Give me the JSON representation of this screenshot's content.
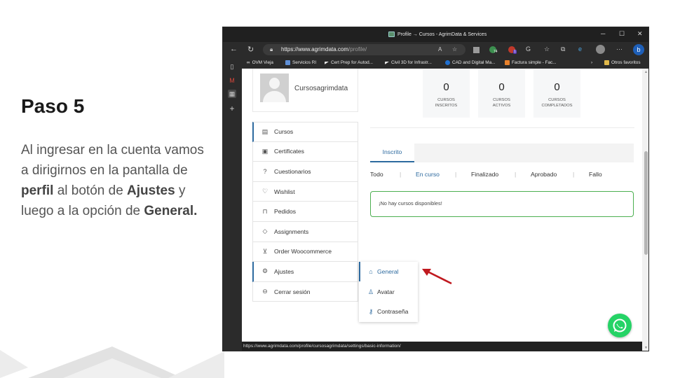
{
  "slide": {
    "title": "Paso 5",
    "text_parts": [
      "Al ingresar en la cuenta vamos a dirigirnos en la pantalla de ",
      "perfil",
      " al botón de ",
      "Ajustes",
      " y luego a la opción de ",
      "General."
    ]
  },
  "browser": {
    "title": "Profile → Cursos - AgrimData & Services",
    "url_domain": "https://www.agrimdata.com",
    "url_path": "/profile/",
    "bookmarks": [
      "OVM Vieja",
      "Servicios RI",
      "Cert Prep for Autod...",
      "Civil 3D for Infrastr...",
      "CAD and Digital Ma...",
      "Factura simple - Fac..."
    ],
    "other_favorites": "Otros favoritos",
    "badges": [
      "74",
      "1"
    ],
    "status_url": "https://www.agrimdata.com/profile/cursosagrimdata/settings/basic-information/"
  },
  "profile": {
    "username": "Cursosagrimdata",
    "menu": [
      {
        "label": "Cursos",
        "icon": "book-icon"
      },
      {
        "label": "Certificates",
        "icon": "certificate-icon"
      },
      {
        "label": "Cuestionarios",
        "icon": "question-icon"
      },
      {
        "label": "Wishlist",
        "icon": "heart-icon"
      },
      {
        "label": "Pedidos",
        "icon": "bag-icon"
      },
      {
        "label": "Assignments",
        "icon": "diamond-icon"
      },
      {
        "label": "Order Woocommerce",
        "icon": "cart-icon"
      },
      {
        "label": "Ajustes",
        "icon": "gear-icon"
      },
      {
        "label": "Cerrar sesión",
        "icon": "logout-icon"
      }
    ],
    "stats": [
      {
        "value": "0",
        "label1": "CURSOS",
        "label2": "INSCRITOS"
      },
      {
        "value": "0",
        "label1": "CURSOS",
        "label2": "ACTIVOS"
      },
      {
        "value": "0",
        "label1": "CURSOS",
        "label2": "COMPLETADOS"
      }
    ],
    "tab": "Inscrito",
    "filters": [
      "Todo",
      "En curso",
      "Finalizado",
      "Aprobado",
      "Fallo"
    ],
    "empty_message": "¡No hay cursos disponibles!",
    "settings_menu": [
      {
        "label": "General",
        "icon": "home-icon"
      },
      {
        "label": "Avatar",
        "icon": "user-icon"
      },
      {
        "label": "Contraseña",
        "icon": "key-icon"
      }
    ]
  },
  "colors": {
    "accent": "#2d6a9f",
    "alert_border": "#4caf50",
    "whatsapp": "#25d366",
    "arrow": "#c0191f"
  }
}
